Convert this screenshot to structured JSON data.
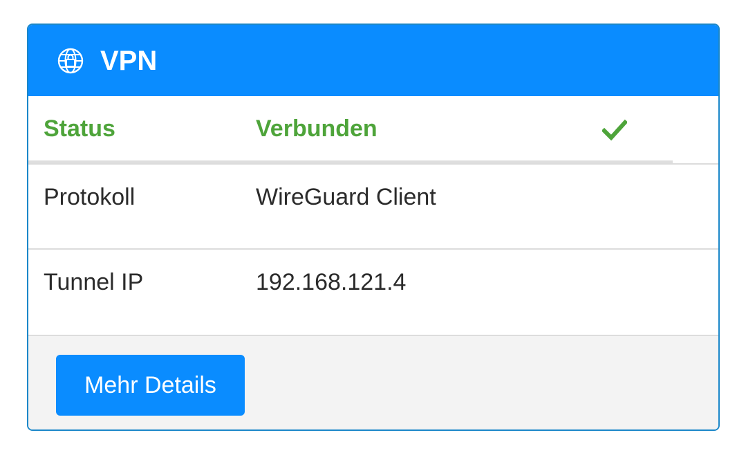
{
  "card": {
    "title": "VPN",
    "icon": "globe-lock-icon",
    "accent_color": "#0a8cff"
  },
  "rows": [
    {
      "label": "Status",
      "value": "Verbunden",
      "status_icon": "checkmark-icon",
      "status_color": "#4ea43a"
    },
    {
      "label": "Protokoll",
      "value": "WireGuard Client"
    },
    {
      "label": "Tunnel IP",
      "value": "192.168.121.4"
    }
  ],
  "footer": {
    "details_button_label": "Mehr Details"
  }
}
